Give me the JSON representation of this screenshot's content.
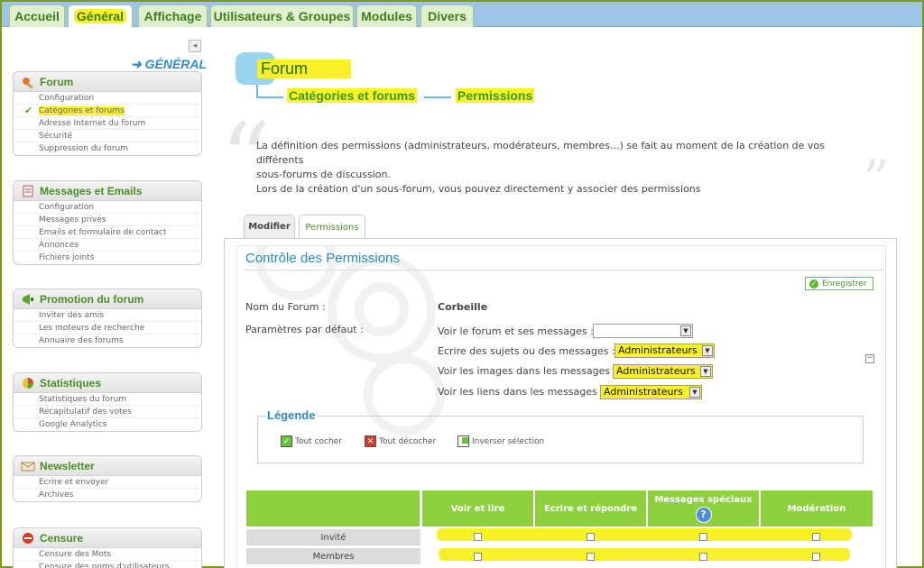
{
  "top_tabs": [
    {
      "label": "Accueil"
    },
    {
      "label": "Général"
    },
    {
      "label": "Affichage"
    },
    {
      "label": "Utilisateurs & Groupes"
    },
    {
      "label": "Modules"
    },
    {
      "label": "Divers"
    }
  ],
  "sidebar": {
    "section_title": "GÉNÉRAL",
    "collapse_label": "◂",
    "groups": [
      {
        "title": "Forum",
        "icon": "wrench-icon",
        "items": [
          "Configuration",
          "Catégories et forums",
          "Adresse Internet du forum",
          "Sécurité",
          "Suppression du forum"
        ]
      },
      {
        "title": "Messages et Emails",
        "icon": "envelope-icon",
        "items": [
          "Configuration",
          "Messages privés",
          "Emails et formulaire de contact",
          "Annonces",
          "Fichiers joints"
        ]
      },
      {
        "title": "Promotion du forum",
        "icon": "megaphone-icon",
        "items": [
          "Inviter des amis",
          "Les moteurs de recherche",
          "Annuaire des forums"
        ]
      },
      {
        "title": "Statistiques",
        "icon": "pie-chart-icon",
        "items": [
          "Statistiques du forum",
          "Récapitulatif des votes",
          "Google Analytics"
        ]
      },
      {
        "title": "Newsletter",
        "icon": "newsletter-icon",
        "items": [
          "Ecrire et envoyer",
          "Archives"
        ]
      },
      {
        "title": "Censure",
        "icon": "forbidden-icon",
        "items": [
          "Censure des Mots",
          "Censure des noms d'utilisateurs"
        ]
      }
    ]
  },
  "main": {
    "title": "Forum",
    "breadcrumb": [
      "Catégories et forums",
      "Permissions"
    ],
    "description": [
      "La définition des permissions (administrateurs, modérateurs, membres...) se fait au moment de la création de vos différents",
      "sous-forums de discussion.",
      "Lors de la création d'un sous-forum, vous pouvez directement y associer des permissions"
    ],
    "tabs": [
      "Modifier",
      "Permissions"
    ],
    "panel_title": "Contrôle des Permissions",
    "save_label": "Enregistrer",
    "forum_name_label": "Nom du Forum :",
    "forum_name_value": "Corbeille",
    "defaults_label": "Paramètres par défaut :",
    "settings": [
      {
        "label": "Voir le forum et ses messages :",
        "value": ""
      },
      {
        "label": "Ecrire des sujets ou des messages :",
        "value": "Administrateurs"
      },
      {
        "label": "Voir les images dans les messages :",
        "value": "Administrateurs"
      },
      {
        "label": "Voir les liens dans les messages :",
        "value": "Administrateurs"
      }
    ],
    "legend_title": "Légende",
    "legend": [
      "Tout cocher",
      "Tout décocher",
      "Inverser sélection"
    ],
    "table_headers": [
      "Voir et lire",
      "Ecrire et répondre",
      "Messages spéciaux",
      "Modération"
    ],
    "help_glyph": "?",
    "rows": [
      "Invité",
      "Membres"
    ]
  }
}
